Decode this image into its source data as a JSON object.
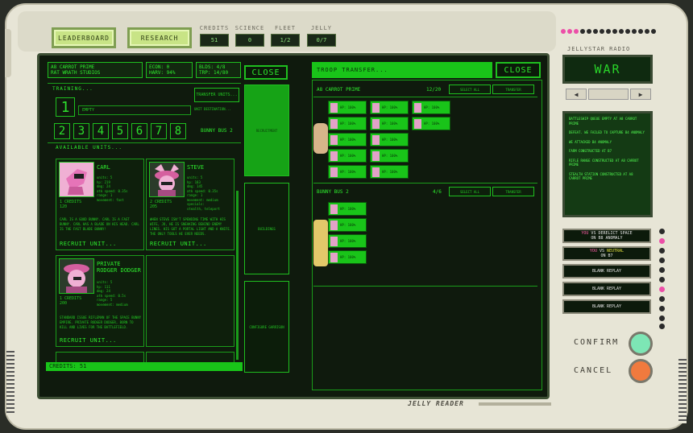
{
  "nav": {
    "leaderboard": "LEADERBOARD",
    "research": "RESEARCH"
  },
  "resources": [
    {
      "label": "CREDITS",
      "value": "51"
    },
    {
      "label": "SCIENCE",
      "value": "0"
    },
    {
      "label": "FLEET",
      "value": "1/2"
    },
    {
      "label": "JELLY",
      "value": "0/7"
    }
  ],
  "left": {
    "planet": "A8 CARROT PRIME",
    "studio": "RAT WRATH STUDIOS",
    "econ": "ECON: 0",
    "harv": "HARV: 94%",
    "blds": "BLDS: 4/8",
    "trp": "TRP: 14/80",
    "training_title": "TRAINING...",
    "transfer_units": "TRANSFER UNITS...",
    "unit_destination": "UNIT DESTINATION...",
    "empty": "EMPTY",
    "bunny_bus": "BUNNY BUS 2",
    "queue_slots": [
      "1",
      "2",
      "3",
      "4",
      "5",
      "6",
      "7",
      "8"
    ],
    "available_units": "AVAILABLE UNITS...",
    "recruit": "RECRUIT UNIT...",
    "credits_bar": "CREDITS: 51"
  },
  "units": [
    {
      "name": "CARL",
      "stats": "units: 5\nhp: 219\ndmg: 24\natk speed: 0.35s\nrange: 1\nmovement: fast",
      "cost": "1 CREDITS\n120",
      "desc": "CARL IS A GOOD BUNNY. CARL IS A FAST BUNNY. CARL HAS A BLADE ON HIS HEAD. CARL IS THE FAST BLADE BUNNY!"
    },
    {
      "name": "STEVE",
      "stats": "units: 5\nhp: 183\ndmg: 145\natk speed: 0.35s\nrange: 1\nmovement: medium\nspecials:\nstealth, teleport",
      "cost": "2 CREDITS\n205",
      "desc": "WHEN STEVE ISN'T SPENDING TIME WITH HIS WIFE, JO, HE IS SNEAKING BEHIND ENEMY LINES. HIS GOT A PORTAL LIGHT AND A KNIFE. THE ONLY TOOLS HE EVER NEEDS."
    },
    {
      "name": "PRIVATE RODGER DODGER",
      "stats": "units: 5\nhp: 111\ndmg: 24\natk speed: 0.5s\nrange: 5\nmovement: medium",
      "cost": "1 CREDITS\n200",
      "desc": "STANDARD ISSUE RIFLEMAN OF THE SPACE BUNNY EMPIRE. PRIVATE RODGER DODGER, BORN TO KILL AND LIVES FOR THE BATTLEFIELD."
    }
  ],
  "middle": {
    "close": "CLOSE",
    "recruitment": "RECRUITMENT",
    "buildings": "BUILDINGS",
    "configure_garrison": "CONFIGURE GARRISON"
  },
  "right": {
    "title": "TROOP TRANSFER...",
    "close": "CLOSE",
    "garrison_name": "A8 CARROT PRIME",
    "garrison_count": "12/20",
    "bus_name": "BUNNY BUS 2",
    "bus_count": "4/6",
    "select_all": "SELECT ALL",
    "transfer": "TRANSFER",
    "troop_label": "HP: 100%"
  },
  "radio": {
    "label": "JELLYSTAR RADIO",
    "mode": "WAR",
    "prev": "◀",
    "next": "▶",
    "log": [
      "BATTLESHIP QUEUE EMPTY AT A8 CARROT PRIME",
      "DEFEAT. WE FAILED TO CAPTURE B4 ANOMALY",
      "WE ATTACKED B4 ANOMALY",
      "FARM CONSTRUCTED AT B7",
      "RIFLE RANGE CONSTRUCTED AT A8 CARROT PRIME",
      "STEALTH STATION CONSTRUCTED AT A8 CARROT PRIME"
    ]
  },
  "replays": [
    {
      "you": "YOU",
      "vs": " VS DERELICT SPACE",
      "line2": "ON B8 ANOMALY",
      "vs_neutral": ""
    },
    {
      "you": "YOU",
      "vs": " VS ",
      "vs_neutral": "NEUTRAL",
      "line2": "ON B7"
    },
    {
      "you": "",
      "vs": "BLANK REPLAY",
      "vs_neutral": "",
      "line2": ""
    },
    {
      "you": "",
      "vs": "BLANK REPLAY",
      "vs_neutral": "",
      "line2": ""
    },
    {
      "you": "",
      "vs": "BLANK REPLAY",
      "vs_neutral": "",
      "line2": ""
    }
  ],
  "controls": {
    "confirm": "CONFIRM",
    "cancel": "CANCEL"
  },
  "brand": "JELLY READER",
  "colors": {
    "accent_green": "#19c419",
    "pink": "#ec4fa8",
    "confirm": "#7de6b5",
    "cancel": "#f07a3e"
  }
}
